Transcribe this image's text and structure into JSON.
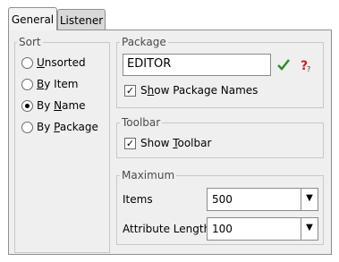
{
  "tabs": [
    {
      "label": "General",
      "active": true
    },
    {
      "label": "Listener",
      "active": false
    }
  ],
  "sort": {
    "title": "Sort",
    "options": [
      {
        "pre": "",
        "key": "U",
        "post": "nsorted",
        "selected": false
      },
      {
        "pre": "",
        "key": "B",
        "post": "y Item",
        "selected": false
      },
      {
        "pre": "By ",
        "key": "N",
        "post": "ame",
        "selected": true
      },
      {
        "pre": "By ",
        "key": "P",
        "post": "ackage",
        "selected": false
      }
    ]
  },
  "package": {
    "title": "Package",
    "input_value": "EDITOR",
    "check_icon": "check-icon",
    "help_icon": "help-question-icon",
    "show_names_pre": "S",
    "show_names_key": "h",
    "show_names_post": "ow Package Names",
    "show_names_checked": true
  },
  "toolbar": {
    "title": "Toolbar",
    "show_pre": "Show ",
    "show_key": "T",
    "show_post": "oolbar",
    "show_checked": true
  },
  "maximum": {
    "title": "Maximum",
    "items_label": "Items",
    "items_value": "500",
    "attr_label": "Attribute Length",
    "attr_value": "100"
  },
  "colors": {
    "check_green": "#2e8b2e",
    "help_red": "#cc2222"
  }
}
